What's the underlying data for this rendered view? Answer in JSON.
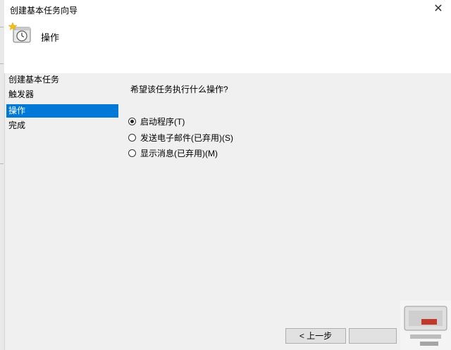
{
  "window": {
    "title": "创建基本任务向导",
    "close_glyph": "✕"
  },
  "header": {
    "page_title": "操作"
  },
  "nav": {
    "items": [
      {
        "label": "创建基本任务"
      },
      {
        "label": "触发器"
      },
      {
        "label": "操作"
      },
      {
        "label": "完成"
      }
    ],
    "active_index": 2
  },
  "content": {
    "question": "希望该任务执行什么操作?",
    "options": [
      {
        "label": "启动程序(T)",
        "checked": true
      },
      {
        "label": "发送电子邮件(已弃用)(S)",
        "checked": false
      },
      {
        "label": "显示消息(已弃用)(M)",
        "checked": false
      }
    ]
  },
  "footer": {
    "back_label": "< 上一步"
  },
  "colors": {
    "selection": "#0078d7",
    "panel_bg": "#f0f0f0",
    "header_bg": "#ffffff"
  },
  "icons": {
    "wizard": "task-clock-icon",
    "close": "close-icon"
  }
}
